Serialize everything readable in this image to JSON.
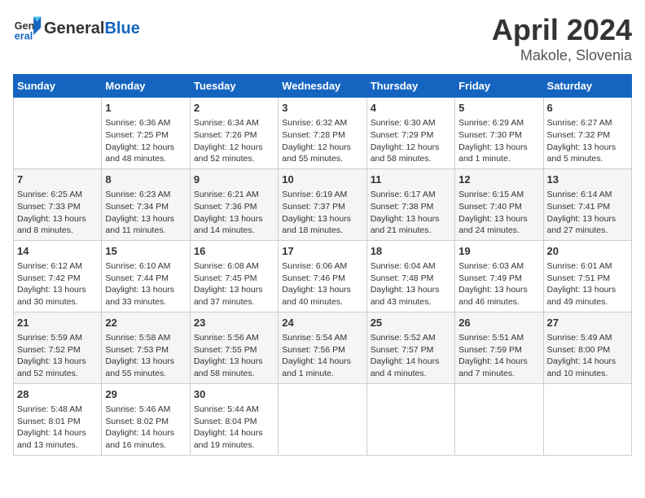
{
  "header": {
    "logo_general": "General",
    "logo_blue": "Blue",
    "title": "April 2024",
    "subtitle": "Makole, Slovenia"
  },
  "days_of_week": [
    "Sunday",
    "Monday",
    "Tuesday",
    "Wednesday",
    "Thursday",
    "Friday",
    "Saturday"
  ],
  "weeks": [
    [
      {
        "num": "",
        "info": ""
      },
      {
        "num": "1",
        "info": "Sunrise: 6:36 AM\nSunset: 7:25 PM\nDaylight: 12 hours\nand 48 minutes."
      },
      {
        "num": "2",
        "info": "Sunrise: 6:34 AM\nSunset: 7:26 PM\nDaylight: 12 hours\nand 52 minutes."
      },
      {
        "num": "3",
        "info": "Sunrise: 6:32 AM\nSunset: 7:28 PM\nDaylight: 12 hours\nand 55 minutes."
      },
      {
        "num": "4",
        "info": "Sunrise: 6:30 AM\nSunset: 7:29 PM\nDaylight: 12 hours\nand 58 minutes."
      },
      {
        "num": "5",
        "info": "Sunrise: 6:29 AM\nSunset: 7:30 PM\nDaylight: 13 hours\nand 1 minute."
      },
      {
        "num": "6",
        "info": "Sunrise: 6:27 AM\nSunset: 7:32 PM\nDaylight: 13 hours\nand 5 minutes."
      }
    ],
    [
      {
        "num": "7",
        "info": "Sunrise: 6:25 AM\nSunset: 7:33 PM\nDaylight: 13 hours\nand 8 minutes."
      },
      {
        "num": "8",
        "info": "Sunrise: 6:23 AM\nSunset: 7:34 PM\nDaylight: 13 hours\nand 11 minutes."
      },
      {
        "num": "9",
        "info": "Sunrise: 6:21 AM\nSunset: 7:36 PM\nDaylight: 13 hours\nand 14 minutes."
      },
      {
        "num": "10",
        "info": "Sunrise: 6:19 AM\nSunset: 7:37 PM\nDaylight: 13 hours\nand 18 minutes."
      },
      {
        "num": "11",
        "info": "Sunrise: 6:17 AM\nSunset: 7:38 PM\nDaylight: 13 hours\nand 21 minutes."
      },
      {
        "num": "12",
        "info": "Sunrise: 6:15 AM\nSunset: 7:40 PM\nDaylight: 13 hours\nand 24 minutes."
      },
      {
        "num": "13",
        "info": "Sunrise: 6:14 AM\nSunset: 7:41 PM\nDaylight: 13 hours\nand 27 minutes."
      }
    ],
    [
      {
        "num": "14",
        "info": "Sunrise: 6:12 AM\nSunset: 7:42 PM\nDaylight: 13 hours\nand 30 minutes."
      },
      {
        "num": "15",
        "info": "Sunrise: 6:10 AM\nSunset: 7:44 PM\nDaylight: 13 hours\nand 33 minutes."
      },
      {
        "num": "16",
        "info": "Sunrise: 6:08 AM\nSunset: 7:45 PM\nDaylight: 13 hours\nand 37 minutes."
      },
      {
        "num": "17",
        "info": "Sunrise: 6:06 AM\nSunset: 7:46 PM\nDaylight: 13 hours\nand 40 minutes."
      },
      {
        "num": "18",
        "info": "Sunrise: 6:04 AM\nSunset: 7:48 PM\nDaylight: 13 hours\nand 43 minutes."
      },
      {
        "num": "19",
        "info": "Sunrise: 6:03 AM\nSunset: 7:49 PM\nDaylight: 13 hours\nand 46 minutes."
      },
      {
        "num": "20",
        "info": "Sunrise: 6:01 AM\nSunset: 7:51 PM\nDaylight: 13 hours\nand 49 minutes."
      }
    ],
    [
      {
        "num": "21",
        "info": "Sunrise: 5:59 AM\nSunset: 7:52 PM\nDaylight: 13 hours\nand 52 minutes."
      },
      {
        "num": "22",
        "info": "Sunrise: 5:58 AM\nSunset: 7:53 PM\nDaylight: 13 hours\nand 55 minutes."
      },
      {
        "num": "23",
        "info": "Sunrise: 5:56 AM\nSunset: 7:55 PM\nDaylight: 13 hours\nand 58 minutes."
      },
      {
        "num": "24",
        "info": "Sunrise: 5:54 AM\nSunset: 7:56 PM\nDaylight: 14 hours\nand 1 minute."
      },
      {
        "num": "25",
        "info": "Sunrise: 5:52 AM\nSunset: 7:57 PM\nDaylight: 14 hours\nand 4 minutes."
      },
      {
        "num": "26",
        "info": "Sunrise: 5:51 AM\nSunset: 7:59 PM\nDaylight: 14 hours\nand 7 minutes."
      },
      {
        "num": "27",
        "info": "Sunrise: 5:49 AM\nSunset: 8:00 PM\nDaylight: 14 hours\nand 10 minutes."
      }
    ],
    [
      {
        "num": "28",
        "info": "Sunrise: 5:48 AM\nSunset: 8:01 PM\nDaylight: 14 hours\nand 13 minutes."
      },
      {
        "num": "29",
        "info": "Sunrise: 5:46 AM\nSunset: 8:02 PM\nDaylight: 14 hours\nand 16 minutes."
      },
      {
        "num": "30",
        "info": "Sunrise: 5:44 AM\nSunset: 8:04 PM\nDaylight: 14 hours\nand 19 minutes."
      },
      {
        "num": "",
        "info": ""
      },
      {
        "num": "",
        "info": ""
      },
      {
        "num": "",
        "info": ""
      },
      {
        "num": "",
        "info": ""
      }
    ]
  ]
}
